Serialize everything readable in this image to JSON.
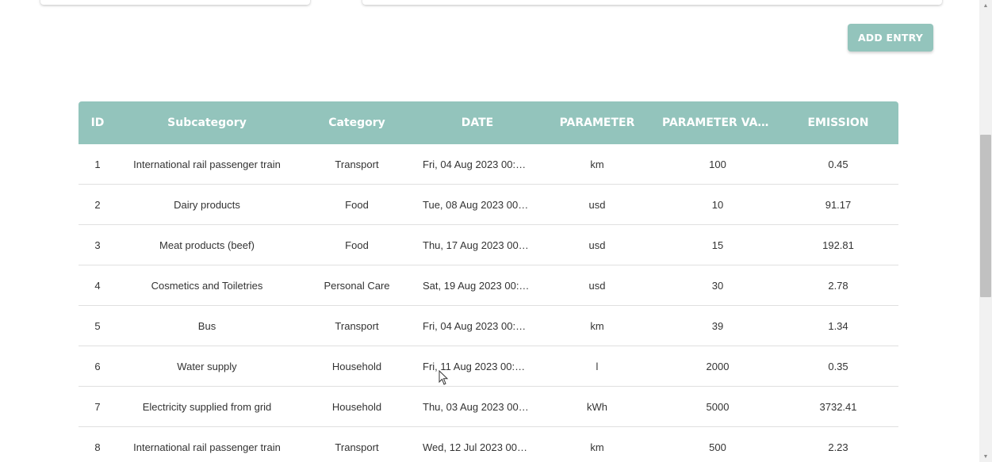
{
  "toolbar": {
    "add_entry_label": "ADD ENTRY"
  },
  "table": {
    "columns": [
      "ID",
      "Subcategory",
      "Category",
      "DATE",
      "PARAMETER",
      "PARAMETER VAL…",
      "EMISSION"
    ],
    "rows": [
      {
        "id": "1",
        "subcategory": "International rail passenger train",
        "category": "Transport",
        "date": "Fri, 04 Aug 2023 00:…",
        "parameter": "km",
        "parameter_value": "100",
        "emission": "0.45"
      },
      {
        "id": "2",
        "subcategory": "Dairy products",
        "category": "Food",
        "date": "Tue, 08 Aug 2023 00…",
        "parameter": "usd",
        "parameter_value": "10",
        "emission": "91.17"
      },
      {
        "id": "3",
        "subcategory": "Meat products (beef)",
        "category": "Food",
        "date": "Thu, 17 Aug 2023 00…",
        "parameter": "usd",
        "parameter_value": "15",
        "emission": "192.81"
      },
      {
        "id": "4",
        "subcategory": "Cosmetics and Toiletries",
        "category": "Personal Care",
        "date": "Sat, 19 Aug 2023 00:…",
        "parameter": "usd",
        "parameter_value": "30",
        "emission": "2.78"
      },
      {
        "id": "5",
        "subcategory": "Bus",
        "category": "Transport",
        "date": "Fri, 04 Aug 2023 00:…",
        "parameter": "km",
        "parameter_value": "39",
        "emission": "1.34"
      },
      {
        "id": "6",
        "subcategory": "Water supply",
        "category": "Household",
        "date": "Fri, 11 Aug 2023 00:…",
        "parameter": "l",
        "parameter_value": "2000",
        "emission": "0.35"
      },
      {
        "id": "7",
        "subcategory": "Electricity supplied from grid",
        "category": "Household",
        "date": "Thu, 03 Aug 2023 00…",
        "parameter": "kWh",
        "parameter_value": "5000",
        "emission": "3732.41"
      },
      {
        "id": "8",
        "subcategory": "International rail passenger train",
        "category": "Transport",
        "date": "Wed, 12 Jul 2023 00…",
        "parameter": "km",
        "parameter_value": "500",
        "emission": "2.23"
      }
    ]
  },
  "colors": {
    "accent": "#93c4bc",
    "header_text": "#ffffff",
    "row_border": "#e0e0e0"
  }
}
